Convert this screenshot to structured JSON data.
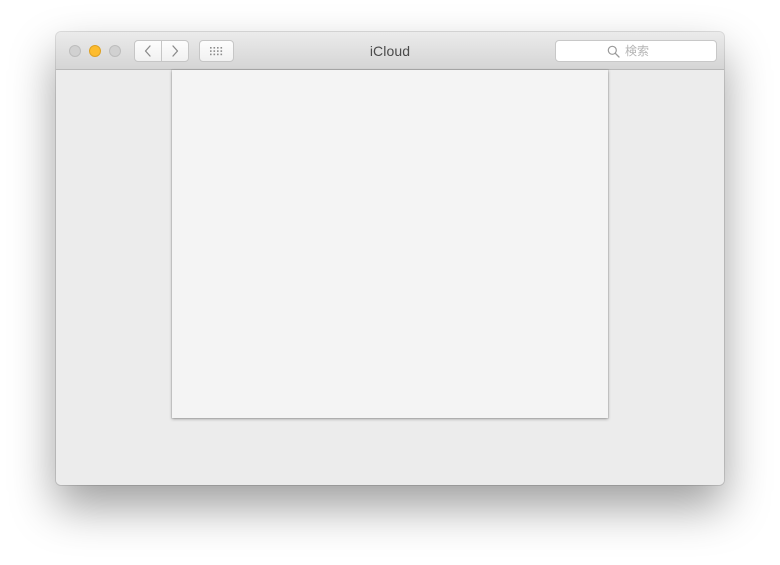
{
  "window": {
    "title": "iCloud"
  },
  "titlebar": {
    "traffic_lights": {
      "close_color": "#d1d1d1",
      "minimize_color": "#fdbc2e",
      "zoom_color": "#d1d1d1"
    },
    "nav": {
      "back_icon": "chevron-left-icon",
      "forward_icon": "chevron-right-icon"
    },
    "show_all_icon": "grid-icon"
  },
  "search": {
    "icon": "search-icon",
    "placeholder": "検索",
    "value": ""
  },
  "colors": {
    "window_bg": "#ececec",
    "panel_bg": "#f4f4f4",
    "title_text": "#4a4a4a"
  }
}
